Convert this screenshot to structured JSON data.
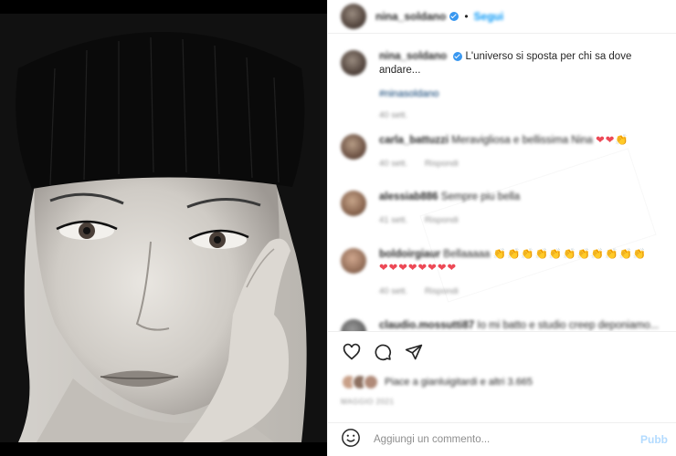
{
  "post": {
    "username": "nina_soldano",
    "follow_label": "Segui",
    "separator": "•"
  },
  "caption": {
    "username": "nina_soldano",
    "text": "L'universo si sposta per chi sa dove andare...",
    "hashtag": "#ninasoldano",
    "time": "40 sett."
  },
  "comments": [
    {
      "username": "carla_battuzzi",
      "text": "Meravigliosa e bellissima Nina",
      "emoji_hearts": "❤❤",
      "emoji_claps": "👏",
      "time": "40 sett.",
      "reply_label": "Rispondi"
    },
    {
      "username": "alessiab886",
      "text": "Sempre piu bella",
      "time": "41 sett.",
      "reply_label": "Rispondi"
    },
    {
      "username": "boldoirgiaur",
      "text": "Bellaaaaa",
      "emoji_claps": "👏👏👏👏👏👏👏👏👏👏👏",
      "emoji_hearts": "❤❤❤❤❤❤❤❤",
      "time": "40 sett.",
      "reply_label": "Rispondi"
    },
    {
      "username": "claudio.mossutti87",
      "text": "Io mi batto e studio creep deponiamo..."
    }
  ],
  "likes": {
    "text": "Piace a gianluigitardi e altri 3.665"
  },
  "date": "MAGGIO 2021",
  "composer": {
    "placeholder": "Aggiungi un commento...",
    "publish_label": "Pubb"
  },
  "colors": {
    "accent": "#0095f6",
    "verified": "#3897f0",
    "heart": "#ed4956",
    "muted": "#8e8e8e"
  },
  "icons": {
    "like": "heart-outline-icon",
    "comment": "comment-bubble-icon",
    "share": "paper-plane-icon",
    "emoji": "smiley-face-icon"
  }
}
